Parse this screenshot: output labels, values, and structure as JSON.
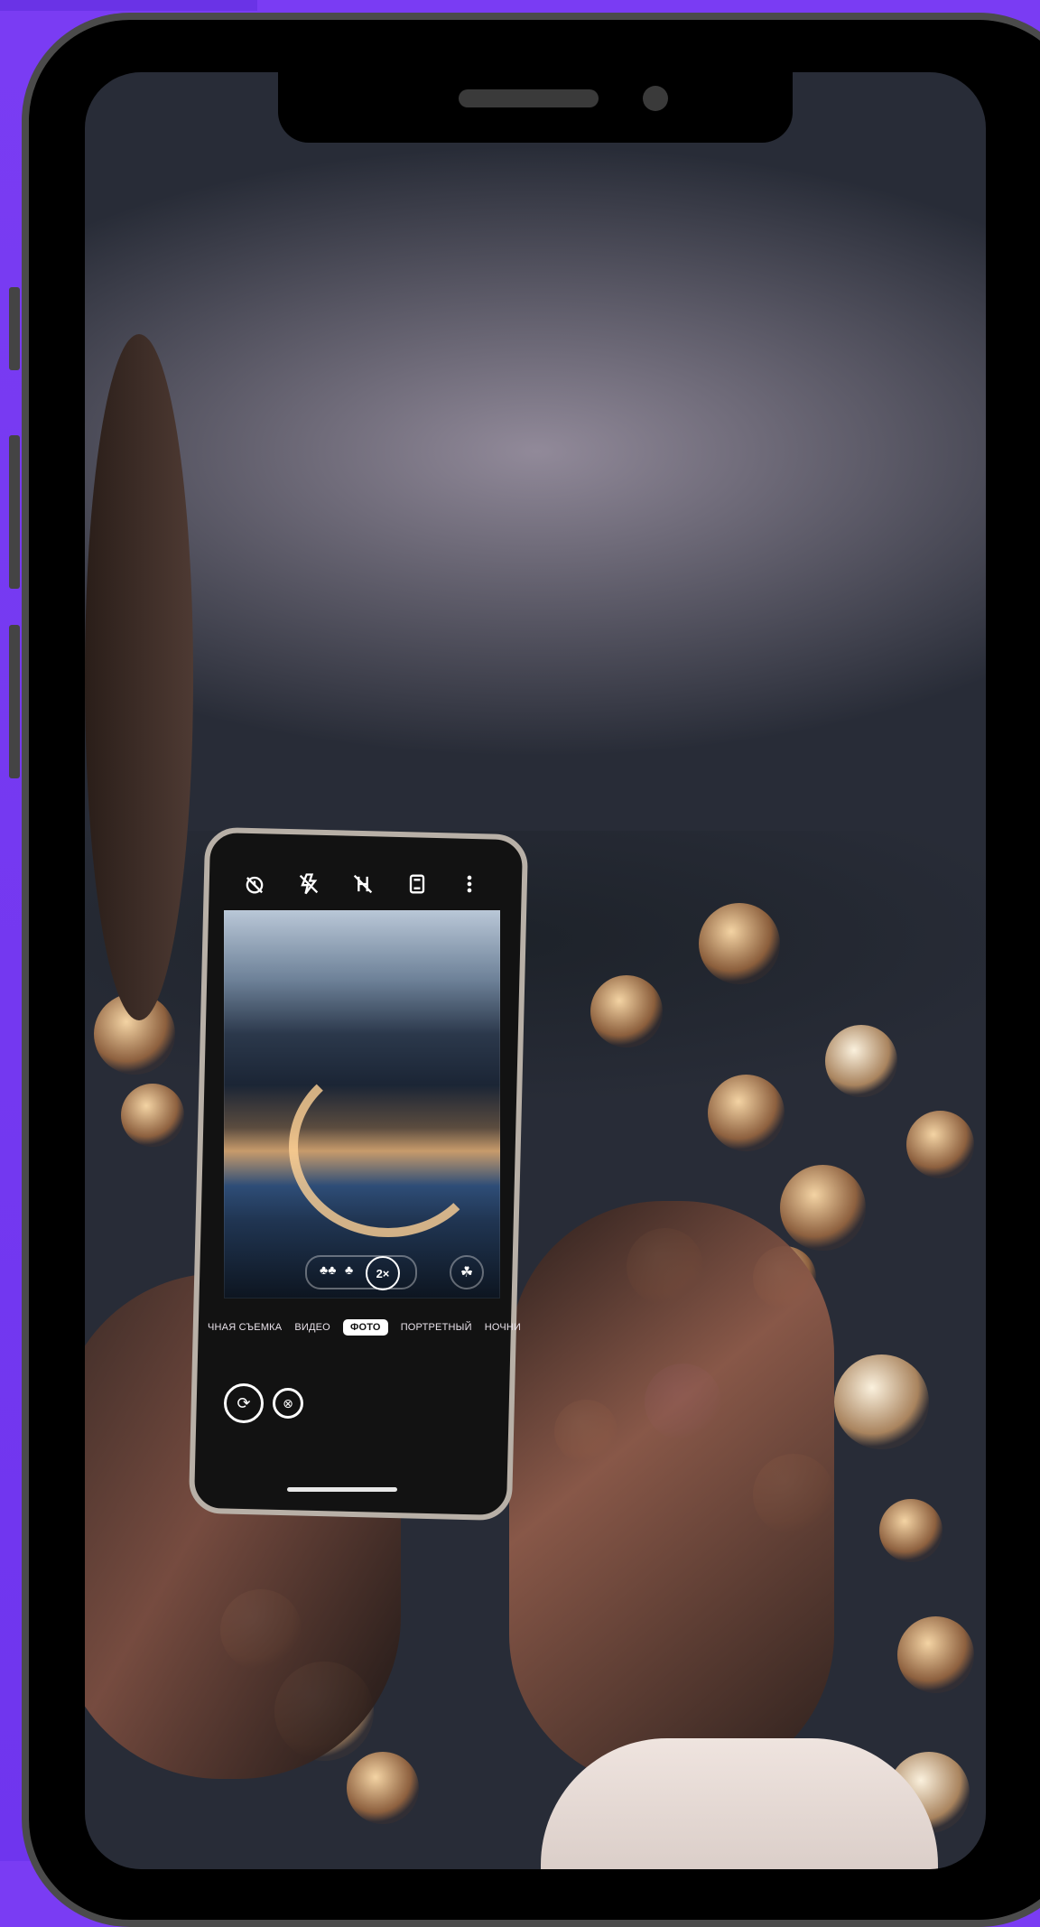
{
  "viewfinder_modes": [
    "ЧНАЯ СЪЕМКА",
    "ВИДЕО",
    "ФОТО",
    "ПОРТРЕТНЫЙ",
    "НОЧНИ"
  ],
  "active_mode": "ФОТО",
  "zoom_level": "2×",
  "top_icons": [
    "timer-off-icon",
    "flash-off-icon",
    "hdr-off-icon",
    "aspect-icon",
    "more-icon"
  ],
  "colors": {
    "background": "#7a3cf3",
    "device_frame": "#4b4b4b",
    "screen_black": "#000000"
  }
}
